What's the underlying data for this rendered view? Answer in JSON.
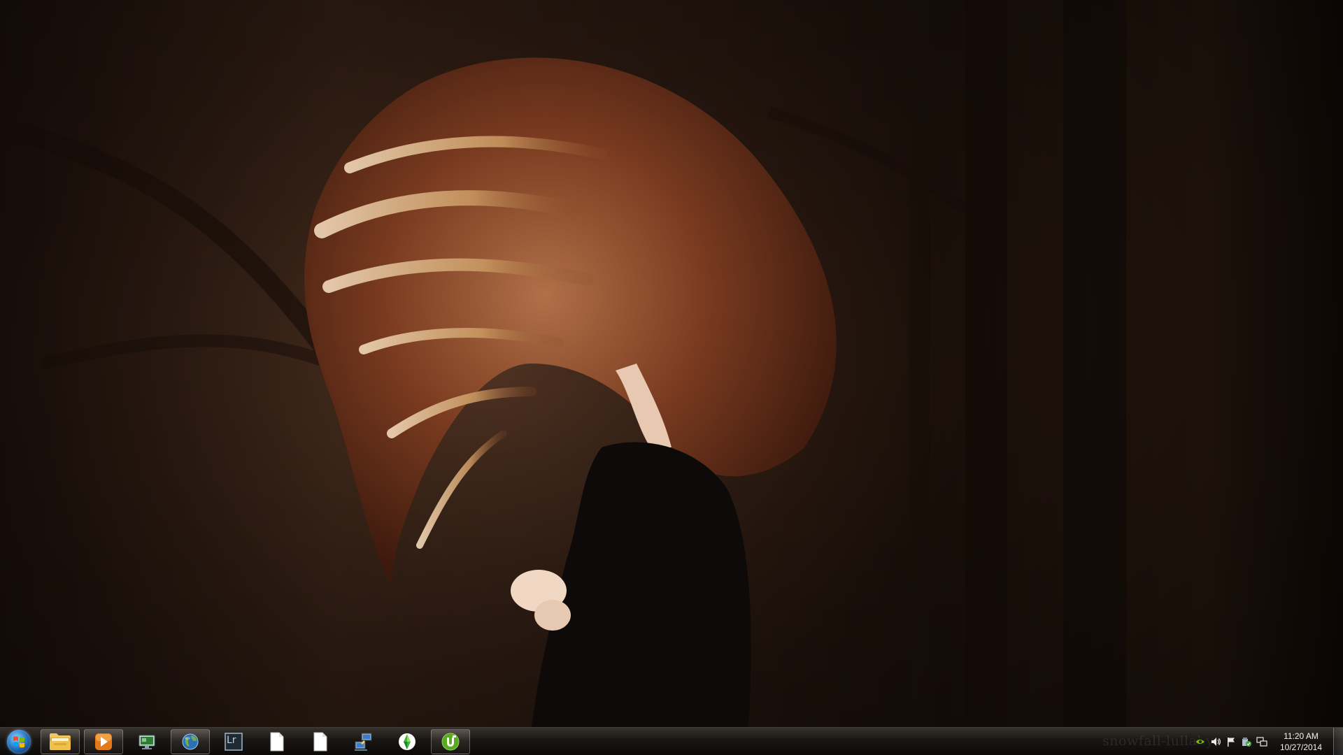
{
  "taskbar": {
    "pinned": [
      {
        "name": "windows-media-player",
        "icon": "media-player-icon",
        "running": true
      },
      {
        "name": "remote-desktop",
        "icon": "remote-desktop-icon",
        "running": false
      },
      {
        "name": "internet-browser",
        "icon": "globe-icon",
        "running": true
      },
      {
        "name": "lightroom",
        "icon": "lightroom-icon",
        "label": "Lr",
        "running": false
      },
      {
        "name": "document-1",
        "icon": "blank-document-icon",
        "running": false
      },
      {
        "name": "document-2",
        "icon": "blank-document-icon",
        "running": false
      },
      {
        "name": "network-tool",
        "icon": "network-computers-icon",
        "running": false
      },
      {
        "name": "the-sims",
        "icon": "plumbob-icon",
        "running": false
      },
      {
        "name": "utorrent",
        "icon": "utorrent-icon",
        "running": true
      }
    ]
  },
  "tray": {
    "watermark": "snowfall-lullaby",
    "icons": [
      "nvidia-icon",
      "volume-icon",
      "action-center-flag-icon",
      "safely-remove-hardware-icon",
      "network-icon"
    ],
    "time": "11:20 AM",
    "date": "10/27/2014"
  },
  "colors": {
    "taskbar_dark": "#121110",
    "start_orb": "#2a7bc9",
    "nvidia_green": "#76b900",
    "utorrent_green": "#5ba823"
  }
}
